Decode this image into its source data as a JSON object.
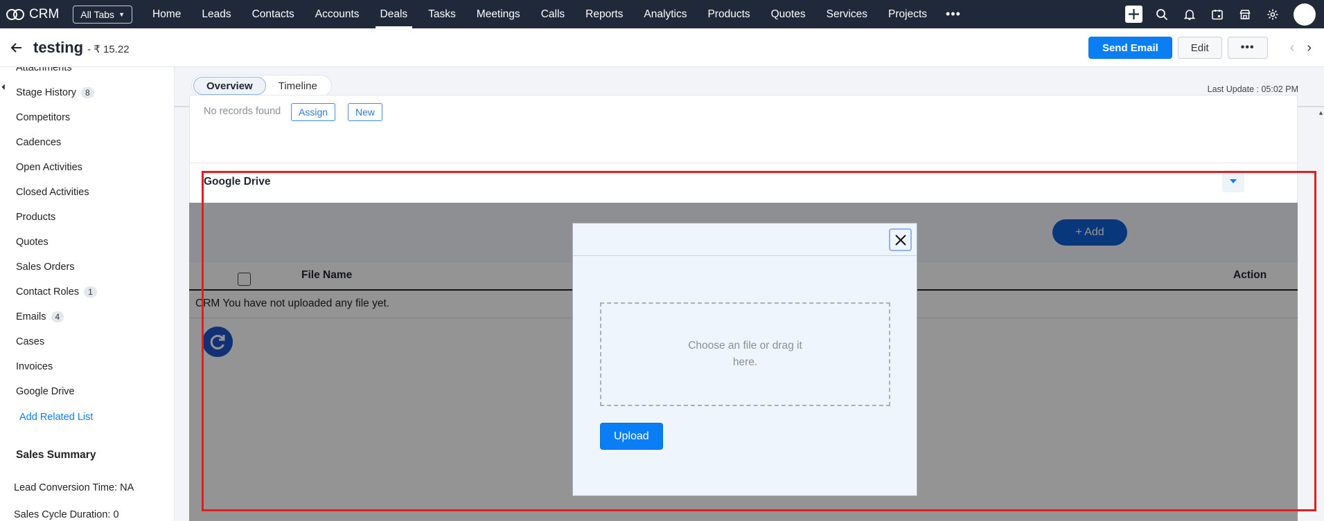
{
  "app": {
    "name": "CRM",
    "all_tabs_label": "All Tabs"
  },
  "nav": {
    "tabs": [
      "Home",
      "Leads",
      "Contacts",
      "Accounts",
      "Deals",
      "Tasks",
      "Meetings",
      "Calls",
      "Reports",
      "Analytics",
      "Products",
      "Quotes",
      "Services",
      "Projects"
    ],
    "active": "Deals",
    "more": "•••"
  },
  "record": {
    "title": "testing",
    "amount": "- ₹ 15.22",
    "send_email": "Send Email",
    "edit": "Edit",
    "more": "•••",
    "prev": "‹",
    "next": "›"
  },
  "sidebar": {
    "items": [
      {
        "label": "Attachments",
        "badge": ""
      },
      {
        "label": "Stage History",
        "badge": "8"
      },
      {
        "label": "Competitors",
        "badge": ""
      },
      {
        "label": "Cadences",
        "badge": ""
      },
      {
        "label": "Open Activities",
        "badge": ""
      },
      {
        "label": "Closed Activities",
        "badge": ""
      },
      {
        "label": "Products",
        "badge": ""
      },
      {
        "label": "Quotes",
        "badge": ""
      },
      {
        "label": "Sales Orders",
        "badge": ""
      },
      {
        "label": "Contact Roles",
        "badge": "1"
      },
      {
        "label": "Emails",
        "badge": "4"
      },
      {
        "label": "Cases",
        "badge": ""
      },
      {
        "label": "Invoices",
        "badge": ""
      },
      {
        "label": "Google Drive",
        "badge": ""
      }
    ],
    "add_related": "Add Related List",
    "summary_heading": "Sales Summary",
    "lead_conversion": "Lead Conversion Time: NA",
    "sales_cycle": "Sales Cycle Duration: 0"
  },
  "tabs": {
    "overview": "Overview",
    "timeline": "Timeline"
  },
  "last_update": "Last Update : 05:02 PM",
  "section_above": {
    "no_records": "No records found",
    "assign": "Assign",
    "new": "New"
  },
  "google_drive": {
    "title": "Google Drive",
    "add": "+ Add",
    "col_file_name": "File Name",
    "col_action": "Action",
    "empty": "CRM You have not uploaded any file yet."
  },
  "modal": {
    "dropzone_text": "Choose an file or drag it here.",
    "upload": "Upload"
  },
  "colors": {
    "nav_bg": "#1f2939",
    "primary": "#0a7ff5",
    "highlight": "#e41e1e"
  }
}
